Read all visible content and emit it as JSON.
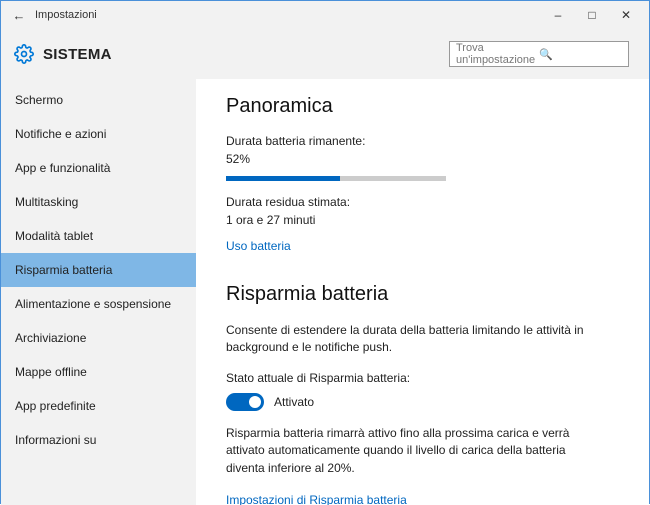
{
  "window": {
    "title": "Impostazioni"
  },
  "header": {
    "heading": "SISTEMA"
  },
  "search": {
    "placeholder": "Trova un'impostazione"
  },
  "sidebar": {
    "items": [
      {
        "label": "Schermo"
      },
      {
        "label": "Notifiche e azioni"
      },
      {
        "label": "App e funzionalità"
      },
      {
        "label": "Multitasking"
      },
      {
        "label": "Modalità tablet"
      },
      {
        "label": "Risparmia batteria"
      },
      {
        "label": "Alimentazione e sospensione"
      },
      {
        "label": "Archiviazione"
      },
      {
        "label": "Mappe offline"
      },
      {
        "label": "App predefinite"
      },
      {
        "label": "Informazioni su"
      }
    ],
    "selectedIndex": 5
  },
  "overview": {
    "title": "Panoramica",
    "remainingLabel": "Durata batteria rimanente:",
    "remainingValue": "52%",
    "remainingPercent": 52,
    "estimatedLabel": "Durata residua stimata:",
    "estimatedValue": "1 ora e 27 minuti",
    "usageLink": "Uso batteria"
  },
  "saver": {
    "title": "Risparmia batteria",
    "desc": "Consente di estendere la durata della batteria limitando le attività in background e le notifiche push.",
    "statusLabel": "Stato attuale di Risparmia batteria:",
    "toggleOn": true,
    "toggleLabel": "Attivato",
    "note": "Risparmia batteria rimarrà attivo fino alla prossima carica e verrà attivato automaticamente quando il livello di carica della batteria diventa inferiore al 20%.",
    "settingsLink": "Impostazioni di Risparmia batteria"
  }
}
